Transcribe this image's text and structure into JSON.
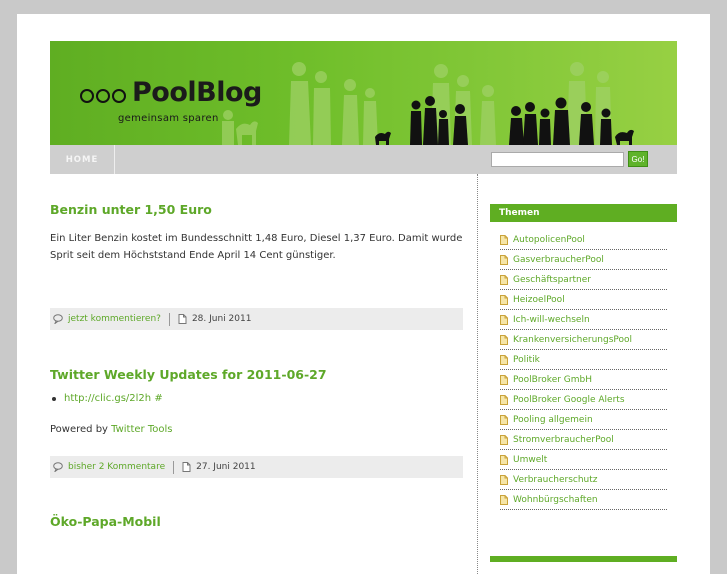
{
  "header": {
    "title": "PoolBlog",
    "subtitle": "gemeinsam sparen"
  },
  "nav": {
    "home_label": "HOME",
    "search_placeholder": "",
    "search_button": "Go!"
  },
  "posts": [
    {
      "title": "Benzin unter 1,50 Euro",
      "text_line1": "Ein Liter Benzin kostet im Bundesschnitt 1,48 Euro, Diesel 1,37 Euro. Damit wurde",
      "text_line2": "Sprit seit dem Höchststand Ende April 14 Cent günstiger.",
      "comments": "jetzt kommentieren?",
      "date": "28. Juni 2011"
    },
    {
      "title": "Twitter Weekly Updates for 2011-06-27",
      "bullet_link": "http://clic.gs/2l2h #",
      "powered_prefix": "Powered by ",
      "powered_link": "Twitter Tools",
      "comments": "bisher 2 Kommentare",
      "date": "27. Juni 2011"
    },
    {
      "title": "Öko-Papa-Mobil"
    }
  ],
  "sidebar": {
    "heading": "Themen",
    "items": [
      "AutopolicenPool",
      "GasverbraucherPool",
      "Geschäftspartner",
      "HeizoelPool",
      "Ich-will-wechseln",
      "KrankenversicherungsPool",
      "Politik",
      "PoolBroker GmbH",
      "PoolBroker Google Alerts",
      "Pooling allgemein",
      "StromverbraucherPool",
      "Umwelt",
      "Verbraucherschutz",
      "Wohnbürgschaften"
    ]
  },
  "colors": {
    "accent": "#5fae22",
    "link": "#5ea829",
    "nav": "#cfcfcf",
    "background": "#c9c9c9"
  }
}
